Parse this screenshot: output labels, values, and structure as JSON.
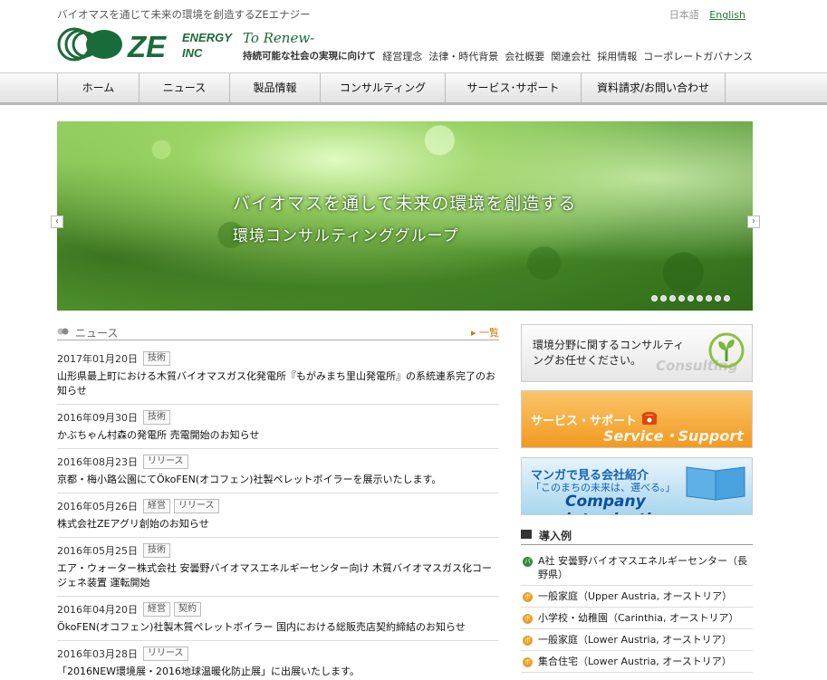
{
  "header": {
    "tagline": "バイオマスを通じて未来の環境を創造するZEエナジー",
    "lang_ja": "日本語",
    "lang_en": "English",
    "logo_ze": "ZE",
    "logo_energy": "ENERGY",
    "logo_inc": "INC",
    "slogan": "To Renew-",
    "slogan_sub": "持続可能な社会の実現に向けて",
    "subnav": [
      "経営理念",
      "法律・時代背景",
      "会社概要",
      "関連会社",
      "採用情報",
      "コーポレートガバナンス"
    ]
  },
  "nav": [
    "ホーム",
    "ニュース",
    "製品情報",
    "コンサルティング",
    "サービス･サポート",
    "資料請求/お問い合わせ"
  ],
  "hero": {
    "line1": "バイオマスを通して未来の環境を創造する",
    "line2": "環境コンサルティンググループ",
    "slides": 9,
    "arrow_left": "‹",
    "arrow_right": "›"
  },
  "news": {
    "title": "ニュース",
    "more": "▸ 一覧",
    "items": [
      {
        "date": "2017年01月20日",
        "tags": [
          "技術"
        ],
        "text": "山形県最上町における木質バイオマスガス化発電所『もがみまち里山発電所』の系統連系完了のお知らせ"
      },
      {
        "date": "2016年09月30日",
        "tags": [
          "技術"
        ],
        "text": "かぶちゃん村森の発電所 売電開始のお知らせ"
      },
      {
        "date": "2016年08月23日",
        "tags": [
          "リリース"
        ],
        "text": "京都・梅小路公園にてÖkoFEN(オコフェン)社製ペレットボイラーを展示いたします。"
      },
      {
        "date": "2016年05月26日",
        "tags": [
          "経営",
          "リリース"
        ],
        "text": "株式会社ZEアグリ創始のお知らせ"
      },
      {
        "date": "2016年05月25日",
        "tags": [
          "技術"
        ],
        "text": "エア・ウォーター株式会社 安曇野バイオマスエネルギーセンター向け 木質バイオマスガス化コージェネ装置 運転開始"
      },
      {
        "date": "2016年04月20日",
        "tags": [
          "経営",
          "契約"
        ],
        "text": "ÖkoFEN(オコフェン)社製木質ペレットボイラー 国内における総販売店契約締結のお知らせ"
      },
      {
        "date": "2016年03月28日",
        "tags": [
          "リリース"
        ],
        "text": "「2016NEW環境展・2016地球温暖化防止展」に出展いたします。"
      }
    ]
  },
  "banners": {
    "consulting_text": "環境分野に関するコンサルティングお任せください。",
    "consulting_en": "Consulting",
    "support_text": "サービス・サポート",
    "support_en": "Service・Support",
    "company_text1": "マンガで見る会社紹介",
    "company_text2": "「このまちの未来は、選べる。」",
    "company_en": "Company introduction"
  },
  "cases": {
    "title": "導入例",
    "items": [
      {
        "icon": "バ",
        "text": "A社 安曇野バイオマスエネルギーセンター（長野県）"
      },
      {
        "icon": "ボ",
        "text": "一般家庭（Upper Austria, オーストリア）"
      },
      {
        "icon": "ボ",
        "text": "小学校・幼稚園（Carinthia, オーストリア）"
      },
      {
        "icon": "ボ",
        "text": "一般家庭（Lower Austria, オーストリア）"
      },
      {
        "icon": "ボ",
        "text": "集合住宅（Lower Austria, オーストリア）"
      }
    ]
  }
}
